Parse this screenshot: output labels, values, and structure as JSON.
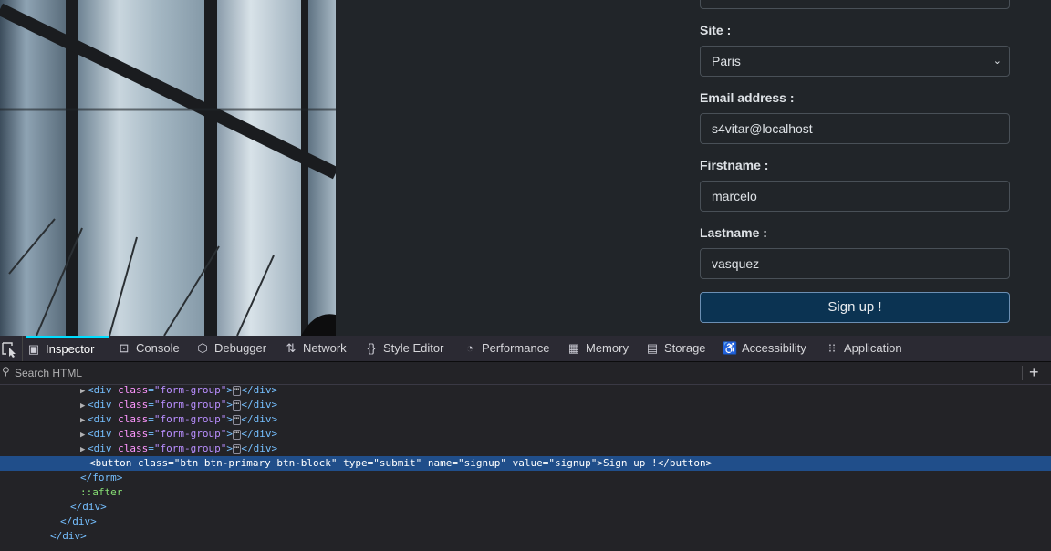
{
  "form": {
    "site": {
      "label": "Site :",
      "value": "Paris"
    },
    "email": {
      "label": "Email address :",
      "value": "s4vitar@localhost"
    },
    "firstname": {
      "label": "Firstname :",
      "value": "marcelo"
    },
    "lastname": {
      "label": "Lastname :",
      "value": "vasquez"
    },
    "submit_label": "Sign up !"
  },
  "devtools": {
    "tabs": [
      {
        "label": "Inspector",
        "icon": "inspector-icon"
      },
      {
        "label": "Console",
        "icon": "console-icon"
      },
      {
        "label": "Debugger",
        "icon": "debugger-icon"
      },
      {
        "label": "Network",
        "icon": "network-icon"
      },
      {
        "label": "Style Editor",
        "icon": "style-editor-icon"
      },
      {
        "label": "Performance",
        "icon": "performance-icon"
      },
      {
        "label": "Memory",
        "icon": "memory-icon"
      },
      {
        "label": "Storage",
        "icon": "storage-icon"
      },
      {
        "label": "Accessibility",
        "icon": "accessibility-icon"
      },
      {
        "label": "Application",
        "icon": "application-icon"
      }
    ],
    "active_tab": "Inspector",
    "search_placeholder": "Search HTML",
    "tree": {
      "form_group_tag": "div",
      "form_group_attr": "class",
      "form_group_value": "\"form-group\"",
      "button_open": "<button",
      "button_attrs": [
        {
          "name": "class",
          "value": "\"btn btn-primary btn-block\""
        },
        {
          "name": "type",
          "value": "\"submit\""
        },
        {
          "name": "name",
          "value": "\"signup\""
        },
        {
          "name": "value",
          "value": "\"signup\""
        }
      ],
      "button_text": "Sign up !",
      "button_close": "</button>",
      "form_close": "</form>",
      "after_pseudo": "::after",
      "div_close": "</div>"
    }
  },
  "colors": {
    "accent": "#00ddff",
    "selection": "#204e8a",
    "button": "#0b3352"
  }
}
